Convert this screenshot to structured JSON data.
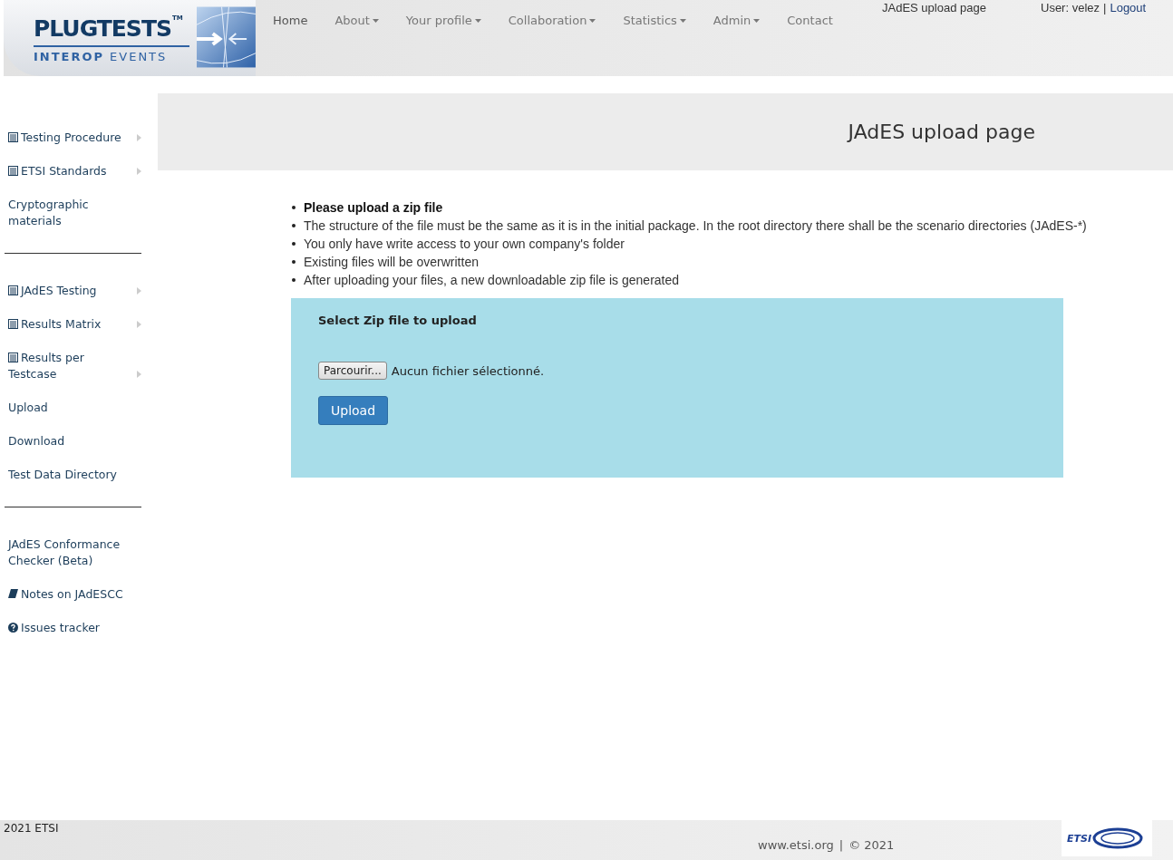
{
  "logo": {
    "title": "PLUGTESTS",
    "trademark": "TM",
    "subtitle_bold": "INTEROP",
    "subtitle": "EVENTS"
  },
  "nav": [
    {
      "label": "Home",
      "dropdown": false
    },
    {
      "label": "About",
      "dropdown": true
    },
    {
      "label": "Your profile",
      "dropdown": true
    },
    {
      "label": "Collaboration",
      "dropdown": true
    },
    {
      "label": "Statistics",
      "dropdown": true
    },
    {
      "label": "Admin",
      "dropdown": true
    },
    {
      "label": "Contact",
      "dropdown": false
    }
  ],
  "page_label": "JAdES upload page",
  "user": "User: velez",
  "separator": "|",
  "logout": "Logout",
  "sidebar": [
    {
      "kind": "list-item",
      "label": "Testing Procedure",
      "submenu": true
    },
    {
      "kind": "list-item",
      "label": "ETSI Standards",
      "submenu": true
    },
    {
      "kind": "item",
      "label": "Cryptographic materials",
      "submenu": false
    },
    {
      "kind": "divider"
    },
    {
      "kind": "list-item",
      "label": "JAdES Testing",
      "submenu": true
    },
    {
      "kind": "list-item",
      "label": "Results Matrix",
      "submenu": true
    },
    {
      "kind": "list-item",
      "label": "Results per Testcase",
      "submenu": true
    },
    {
      "kind": "item",
      "label": "Upload",
      "submenu": false
    },
    {
      "kind": "item",
      "label": "Download",
      "submenu": false
    },
    {
      "kind": "item",
      "label": "Test Data Directory",
      "submenu": false
    },
    {
      "kind": "divider"
    },
    {
      "kind": "item",
      "label": "JAdES Conformance Checker (Beta)",
      "submenu": false
    },
    {
      "kind": "book-item",
      "label": "Notes on JAdESCC",
      "submenu": false
    },
    {
      "kind": "help-item",
      "label": "Issues tracker",
      "submenu": false
    }
  ],
  "heading": "JAdES upload page",
  "instructions": [
    {
      "text": "Please upload a zip file",
      "bold": true
    },
    {
      "text": "The structure of the file must be the same as it is in the initial package. In the root directory there shall be the scenario directories (JAdES-*)",
      "bold": false
    },
    {
      "text": "You only have write access to your own company's folder",
      "bold": false
    },
    {
      "text": "Existing files will be overwritten",
      "bold": false
    },
    {
      "text": "After uploading your files, a new downloadable zip file is generated",
      "bold": false
    }
  ],
  "upload_form": {
    "title": "Select Zip file to upload",
    "browse_button": "Parcourir...",
    "file_status": "Aucun fichier sélectionné.",
    "submit": "Upload"
  },
  "footer": {
    "copyright": "2021 ETSI",
    "site": "www.etsi.org",
    "separator": "|",
    "year": "© 2021",
    "logo_text": "ETSI"
  }
}
